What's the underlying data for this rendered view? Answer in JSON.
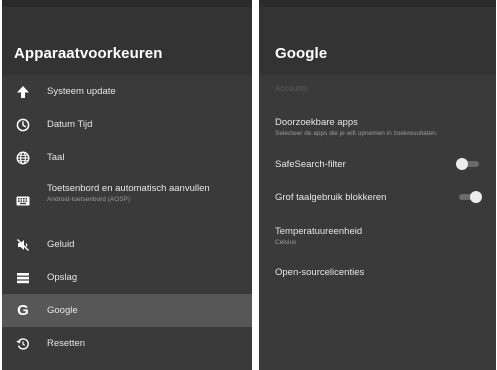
{
  "left_panel": {
    "title": "Apparaatvoorkeuren",
    "items": [
      {
        "label": "Systeem update",
        "icon": "arrow-up-icon"
      },
      {
        "label": "Datum Tijd",
        "icon": "clock-icon"
      },
      {
        "label": "Taal",
        "icon": "globe-icon"
      },
      {
        "label": "Toetsenbord en automatisch aanvullen",
        "sublabel": "Android-toetsenbord (AOSP)",
        "icon": "keyboard-icon"
      },
      {
        "label": "Geluid",
        "icon": "sound-off-icon"
      },
      {
        "label": "Opslag",
        "icon": "storage-icon"
      },
      {
        "label": "Google",
        "icon": "google-icon",
        "selected": true
      },
      {
        "label": "Resetten",
        "icon": "reset-icon"
      }
    ]
  },
  "right_panel": {
    "title": "Google",
    "section_label": "Accounts",
    "items": [
      {
        "label": "Doorzoekbare apps",
        "sublabel": "Selecteer de apps die je wilt opnemen in zoekresultaten."
      },
      {
        "label": "SafeSearch-filter",
        "toggle": "off"
      },
      {
        "label": "Grof taalgebruik blokkeren",
        "toggle": "on"
      },
      {
        "label": "Temperatuureenheid",
        "sublabel": "Celsius"
      },
      {
        "label": "Open-sourcelicenties"
      }
    ]
  },
  "colors": {
    "panel_bg": "#3a3a3a",
    "header_bg": "#333333",
    "selected_bg": "#575757",
    "text": "#e6e6e6",
    "subtext": "#9a9a9a"
  }
}
